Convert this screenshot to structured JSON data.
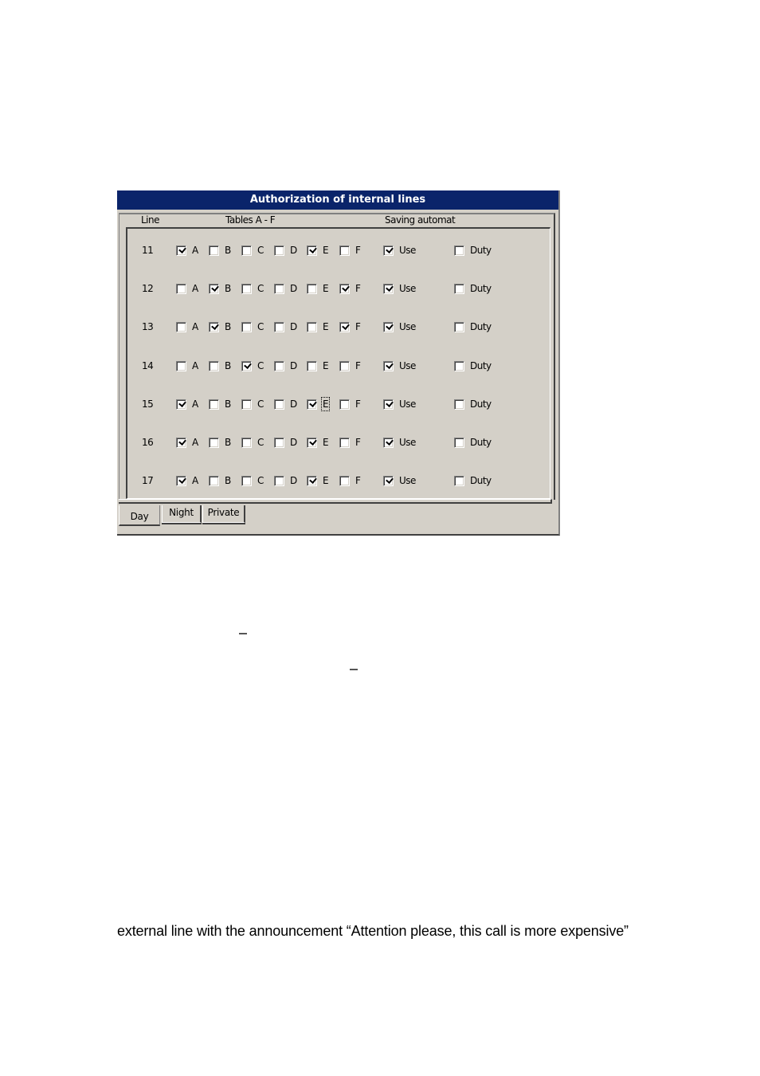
{
  "dialog": {
    "title": "Authorization of internal lines",
    "headers": {
      "line": "Line",
      "tables": "Tables A - F",
      "saving": "Saving automat"
    },
    "table_letters": [
      "A",
      "B",
      "C",
      "D",
      "E",
      "F"
    ],
    "use_label": "Use",
    "duty_label": "Duty",
    "rows": [
      {
        "line": "11",
        "tables": [
          true,
          false,
          false,
          false,
          true,
          false
        ],
        "use": true,
        "duty": false
      },
      {
        "line": "12",
        "tables": [
          false,
          true,
          false,
          false,
          false,
          true
        ],
        "use": true,
        "duty": false
      },
      {
        "line": "13",
        "tables": [
          false,
          true,
          false,
          false,
          false,
          true
        ],
        "use": true,
        "duty": false
      },
      {
        "line": "14",
        "tables": [
          false,
          false,
          true,
          false,
          false,
          false
        ],
        "use": true,
        "duty": false
      },
      {
        "line": "15",
        "tables": [
          true,
          false,
          false,
          false,
          true,
          false
        ],
        "use": true,
        "duty": false,
        "focused": "E"
      },
      {
        "line": "16",
        "tables": [
          true,
          false,
          false,
          false,
          true,
          false
        ],
        "use": true,
        "duty": false
      },
      {
        "line": "17",
        "tables": [
          true,
          false,
          false,
          false,
          true,
          false
        ],
        "use": true,
        "duty": false
      }
    ],
    "tabs": [
      {
        "label": "Day",
        "active": true
      },
      {
        "label": "Night",
        "active": false
      },
      {
        "label": "Private",
        "active": false
      }
    ]
  },
  "page": {
    "text_line": "external line with the announcement “Attention please, this call is more expensive”"
  }
}
